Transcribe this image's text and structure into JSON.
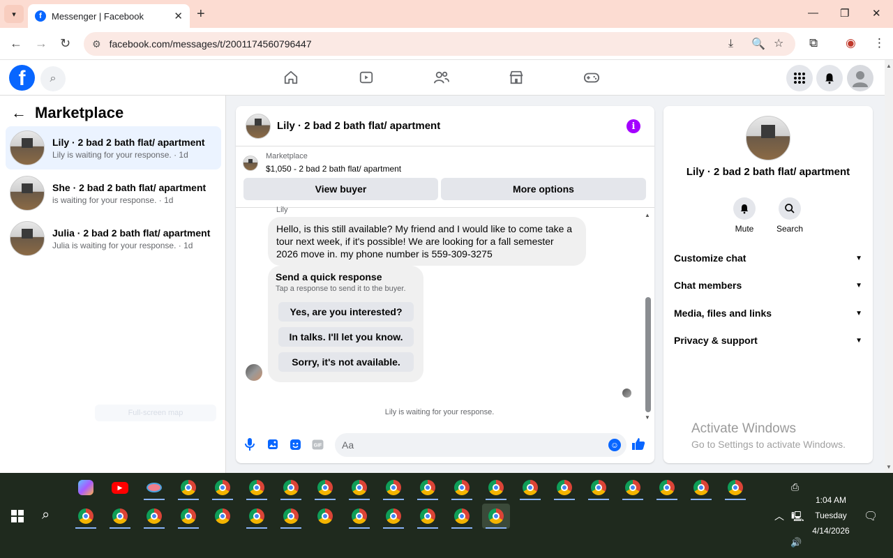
{
  "browser": {
    "tab_title": "Messenger | Facebook",
    "url": "facebook.com/messages/t/2001174560796447"
  },
  "left": {
    "title": "Marketplace",
    "conversations": [
      {
        "name": "Lily · 2 bad 2 bath flat/ apartment",
        "sub": "Lily is waiting for your response. · 1d"
      },
      {
        "name": "She · 2 bad 2 bath flat/ apartment",
        "sub": "is waiting for your response. · 1d"
      },
      {
        "name": "Julia · 2 bad 2 bath flat/ apartment",
        "sub": "Julia is waiting for your response. · 1d"
      }
    ],
    "full_screen_map": "Full-screen map"
  },
  "chat": {
    "title": "Lily · 2 bad 2 bath flat/ apartment",
    "listing_label": "Marketplace",
    "listing_title": "$1,050 - 2 bad 2 bath flat/ apartment",
    "view_buyer": "View buyer",
    "more_options": "More options",
    "sender": "Lily",
    "message": "Hello, is this still available? My friend and I would like to come take a tour next week, if it's possible! We are looking for a fall semester 2026 move in. my phone number is 559-309-3275",
    "quick_title": "Send a quick response",
    "quick_sub": "Tap a response to send it to the buyer.",
    "quick_replies": [
      "Yes, are you interested?",
      "In talks. I'll let you know.",
      "Sorry, it's not available."
    ],
    "waiting": "Lily is waiting for your response.",
    "input_placeholder": "Aa"
  },
  "info": {
    "name": "Lily · 2 bad 2 bath flat/ apartment",
    "mute": "Mute",
    "search": "Search",
    "sections": [
      "Customize chat",
      "Chat members",
      "Media, files and links",
      "Privacy & support"
    ]
  },
  "watermark": {
    "line1": "Activate Windows",
    "line2": "Go to Settings to activate Windows."
  },
  "taskbar": {
    "time": "1:04 AM",
    "day": "Tuesday",
    "date": "4/14/2026"
  },
  "colors": {
    "accent": "#0866ff",
    "info": "#a400ff",
    "tabbar": "#fcdcd2",
    "taskbar": "#1f2a1e"
  }
}
